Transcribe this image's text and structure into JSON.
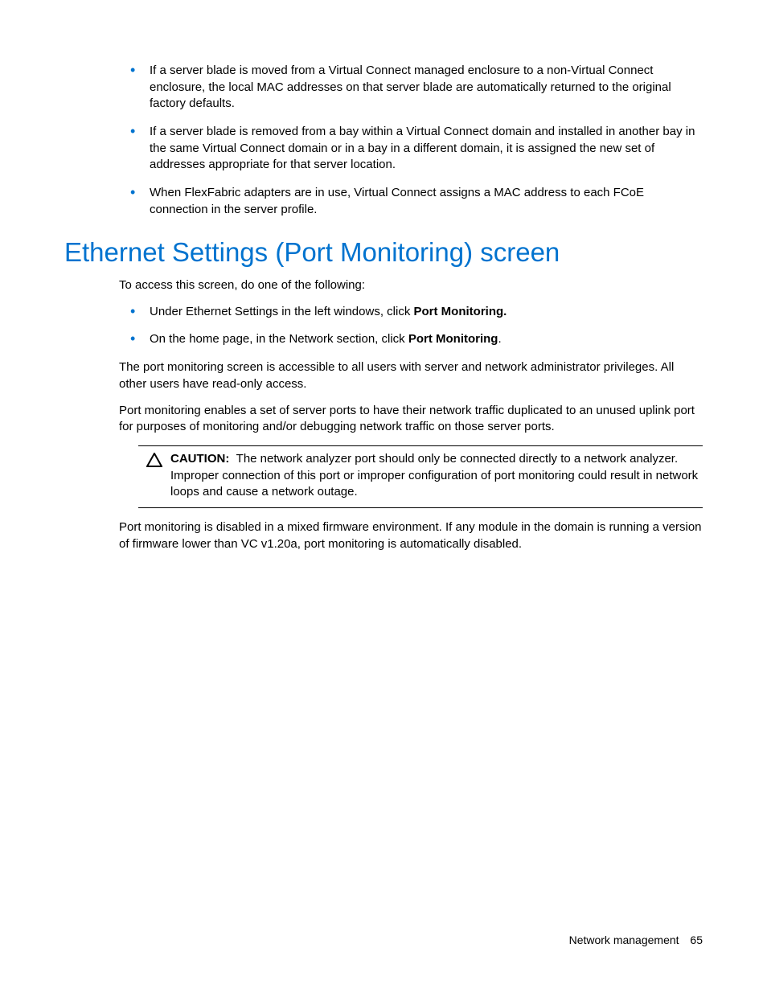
{
  "top_bullets": [
    "If a server blade is moved from a Virtual Connect managed enclosure to a non-Virtual Connect enclosure, the local MAC addresses on that server blade are automatically returned to the original factory defaults.",
    "If a server blade is removed from a bay within a Virtual Connect domain and installed in another bay in the same Virtual Connect domain or in a bay in a different domain, it is assigned the new set of addresses appropriate for that server location.",
    "When FlexFabric adapters are in use, Virtual Connect assigns a MAC address to each FCoE connection in the server profile."
  ],
  "heading": "Ethernet Settings (Port Monitoring) screen",
  "intro": "To access this screen, do one of the following:",
  "access_bullets": [
    {
      "pre": "Under Ethernet Settings in the left windows, click ",
      "bold": "Port Monitoring.",
      "post": ""
    },
    {
      "pre": "On the home page, in the Network section, click ",
      "bold": "Port Monitoring",
      "post": "."
    }
  ],
  "para1": "The port monitoring screen is accessible to all users with server and network administrator privileges. All other users have read-only access.",
  "para2": "Port monitoring enables a set of server ports to have their network traffic duplicated to an unused uplink port for purposes of monitoring and/or debugging network traffic on those server ports.",
  "caution_label": "CAUTION:",
  "caution_text": "The network analyzer port should only be connected directly to a network analyzer. Improper connection of this port or improper configuration of port monitoring could result in network loops and cause a network outage.",
  "para3": "Port monitoring is disabled in a mixed firmware environment. If any module in the domain is running a version of firmware lower than VC v1.20a, port monitoring is automatically disabled.",
  "footer_section": "Network management",
  "footer_page": "65"
}
